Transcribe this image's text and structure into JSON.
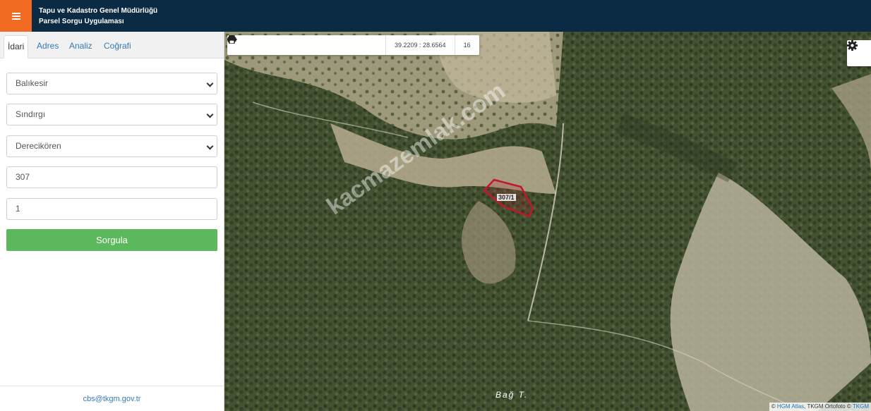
{
  "header": {
    "title_line1": "Tapu ve Kadastro Genel Müdürlüğü",
    "title_line2": "Parsel Sorgu Uygulaması",
    "menu_icon": "hamburger-icon"
  },
  "sidebar": {
    "tabs": [
      {
        "label": "İdari",
        "active": true
      },
      {
        "label": "Adres",
        "active": false
      },
      {
        "label": "Analiz",
        "active": false
      },
      {
        "label": "Coğrafi",
        "active": false
      }
    ],
    "form": {
      "province": "Balıkesir",
      "district": "Sındırgı",
      "neighborhood": "Derecikören",
      "block": "307",
      "parcel": "1",
      "submit_label": "Sorgula"
    },
    "footer_email": "cbs@tkgm.gov.tr"
  },
  "map": {
    "toolbar": {
      "buttons": [
        "zoom-in-icon",
        "zoom-out-icon",
        "refresh-icon",
        "locate-icon",
        "info-icon",
        "favorite-icon",
        "measure-icon",
        "print-icon"
      ],
      "coordinates": "39.2209 : 28.6564",
      "zoom": "16"
    },
    "parcel_label": "307/1",
    "watermark": "kacmazemlak.com",
    "place_label": "Bağ T.",
    "attribution": {
      "prefix": "© ",
      "hgm": "HGM Atlas",
      "middle": ", TKGM Ortofoto © ",
      "tkgm": "TKGM"
    },
    "colors": {
      "parcel_stroke": "#c0182a",
      "forest": "#3f4d2f",
      "clearing": "#b4ad92"
    }
  }
}
